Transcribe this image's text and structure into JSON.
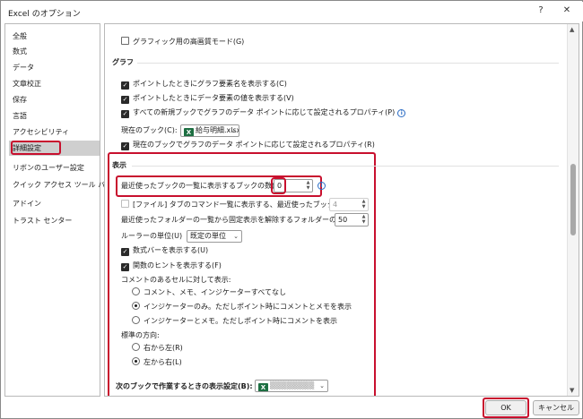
{
  "window": {
    "title": "Excel のオプション",
    "help_glyph": "?",
    "close_glyph": "✕"
  },
  "nav": {
    "items": [
      {
        "label": "全般"
      },
      {
        "label": "数式"
      },
      {
        "label": "データ"
      },
      {
        "label": "文章校正"
      },
      {
        "label": "保存"
      },
      {
        "label": "言語"
      },
      {
        "label": "アクセシビリティ"
      },
      {
        "label": "詳細設定",
        "selected": true
      },
      {
        "label": "リボンのユーザー設定"
      },
      {
        "label": "クイック アクセス ツール バー"
      },
      {
        "label": "アドイン"
      },
      {
        "label": "トラスト センター"
      }
    ]
  },
  "content": {
    "hq_graphics": {
      "label": "グラフィック用の高画質モード(G)",
      "checked": false
    },
    "graph_section": "グラフ",
    "graph_opts": [
      {
        "label": "ポイントしたときにグラフ要素名を表示する(C)",
        "checked": true
      },
      {
        "label": "ポイントしたときにデータ要素の値を表示する(V)",
        "checked": true
      },
      {
        "label": "すべての新規ブックでグラフのデータ ポイントに応じて設定されるプロパティ(P)",
        "checked": true
      }
    ],
    "current_book_label": "現在のブック(C):",
    "current_book_value": "給与明細.xlsx",
    "current_book_prop": {
      "label": "現在のブックでグラフのデータ ポイントに応じて設定されるプロパティ(R)",
      "checked": true
    },
    "display_section": "表示",
    "recent_books": {
      "label": "最近使ったブックの一覧に表示するブックの数(R):",
      "value": "0"
    },
    "quick_access": {
      "label": "[ファイル] タブのコマンド一覧に表示する、最近使ったブックの数(Q):",
      "value": "4",
      "checked": false
    },
    "unpin_folders": {
      "label": "最近使ったフォルダーの一覧から固定表示を解除するフォルダーの数(F):",
      "value": "50"
    },
    "ruler": {
      "label": "ルーラーの単位(U)",
      "value": "既定の単位"
    },
    "formula_bar": {
      "label": "数式バーを表示する(U)",
      "checked": true
    },
    "function_tips": {
      "label": "関数のヒントを表示する(F)",
      "checked": true
    },
    "comments_label": "コメントのあるセルに対して表示:",
    "comment_opts": [
      {
        "label": "コメント、メモ、インジケーターすべてなし",
        "selected": false
      },
      {
        "label": "インジケーターのみ。ただしポイント時にコメントとメモを表示",
        "selected": true
      },
      {
        "label": "インジケーターとメモ。ただしポイント時にコメントを表示",
        "selected": false
      }
    ],
    "direction_label": "標準の方向:",
    "direction_opts": [
      {
        "label": "右から左(R)",
        "selected": false
      },
      {
        "label": "左から右(L)",
        "selected": true
      }
    ],
    "next_book_label": "次のブックで作業するときの表示設定(B):"
  },
  "footer": {
    "ok": "OK",
    "cancel": "キャンセル"
  },
  "colors": {
    "highlight_red": "#c8102e",
    "excel_green": "#1d6f42",
    "info_blue": "#2b6cc4"
  }
}
